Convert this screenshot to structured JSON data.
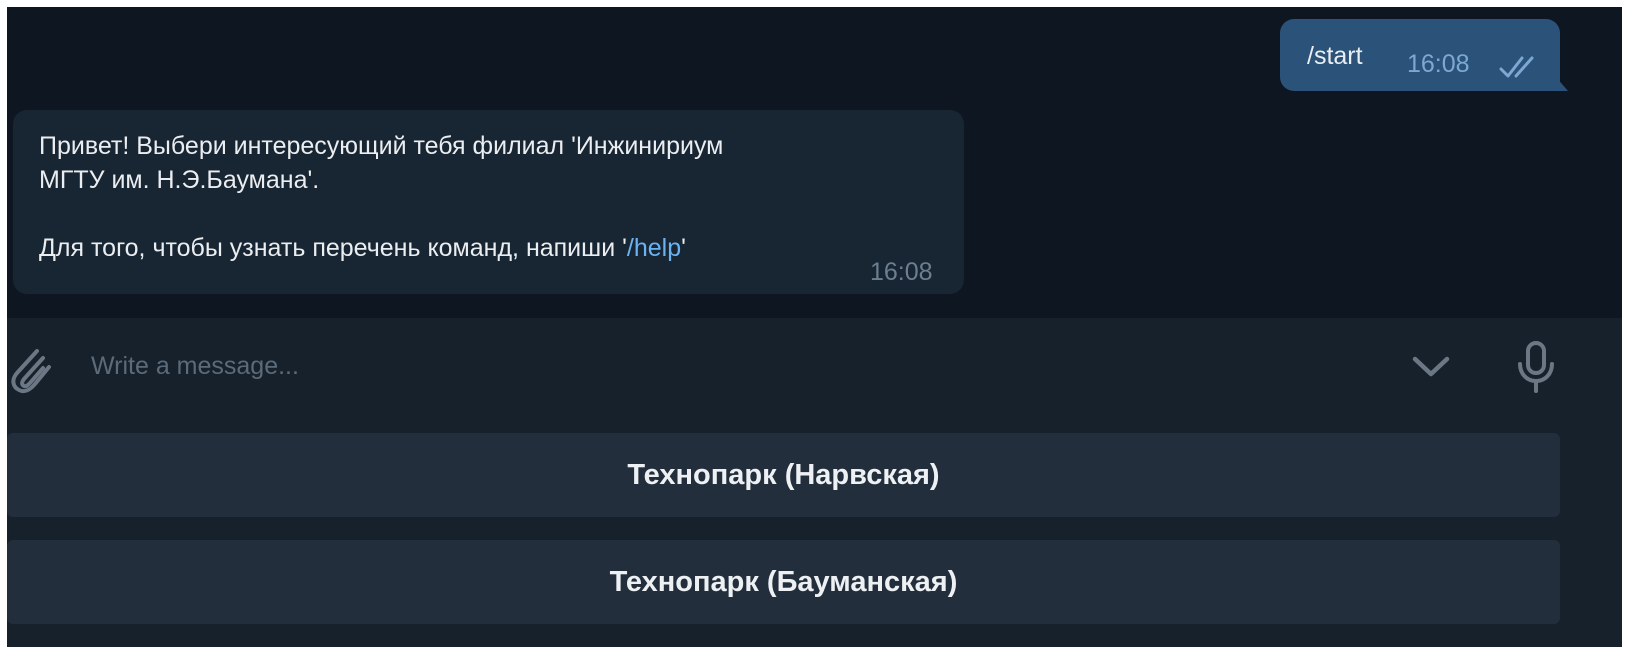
{
  "outgoing_message": {
    "text": "/start",
    "time": "16:08",
    "status_icon": "double-check-icon"
  },
  "incoming_message": {
    "line1": "Привет! Выбери интересующий тебя филиал 'Инжинириум",
    "line2": "МГТУ им. Н.Э.Баумана'.",
    "line3_prefix": "Для того, чтобы узнать перечень команд, напиши '",
    "line3_link": "/help",
    "line3_suffix": "'",
    "time": "16:08"
  },
  "composer": {
    "placeholder": "Write a message...",
    "attach_icon": "paperclip-icon",
    "toggle_keyboard_icon": "chevron-down-icon",
    "voice_icon": "microphone-icon"
  },
  "reply_keyboard": {
    "buttons": [
      {
        "label": "Технопарк (Нарвская)"
      },
      {
        "label": "Технопарк (Бауманская)"
      }
    ]
  },
  "colors": {
    "chat_background": "#0e1621",
    "outgoing_bubble": "#2b5278",
    "incoming_bubble": "#182533",
    "panel_background": "#17212b",
    "keyboard_button": "#232e3c",
    "link": "#6ab3f3"
  }
}
